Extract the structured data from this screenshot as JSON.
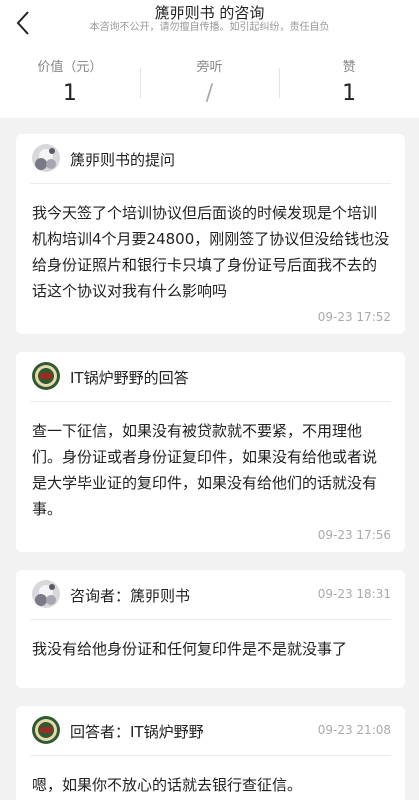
{
  "header": {
    "back_icon": "chevron-left-icon",
    "title": "篪戼则书 的咨询",
    "subtitle": "本咨询不公开，请勿擅自传播。如引起纠纷，责任自负"
  },
  "stats": [
    {
      "label": "价值（元）",
      "value": "1"
    },
    {
      "label": "旁听",
      "value": "/"
    },
    {
      "label": "赞",
      "value": "1"
    }
  ],
  "thread": [
    {
      "head": "篪戼则书的提问",
      "body": "我今天签了个培训协议但后面谈的时候发现是个培训机构培训4个月要24800，刚刚签了协议但没给钱也没给身份证照片和银行卡只填了身份证号后面我不去的话这个协议对我有什么影响吗",
      "time": "09-23 17:52",
      "avatar": "user-avatar"
    },
    {
      "head": "IT锅炉野野的回答",
      "body": "查一下征信，如果没有被贷款就不要紧，不用理他们。身份证或者身份证复印件，如果没有给他或者说是大学毕业证的复印件，如果没有给他们的话就没有事。",
      "time": "09-23 17:56",
      "avatar": "lawyer-avatar"
    },
    {
      "head": "咨询者：篪戼则书",
      "head_time": "09-23 18:31",
      "body": "我没有给他身份证和任何复印件是不是就没事了",
      "avatar": "user-avatar"
    },
    {
      "head": "回答者：IT锅炉野野",
      "head_time": "09-23 21:08",
      "body": "嗯，如果你不放心的话就去银行查征信。",
      "avatar": "lawyer-avatar"
    }
  ]
}
